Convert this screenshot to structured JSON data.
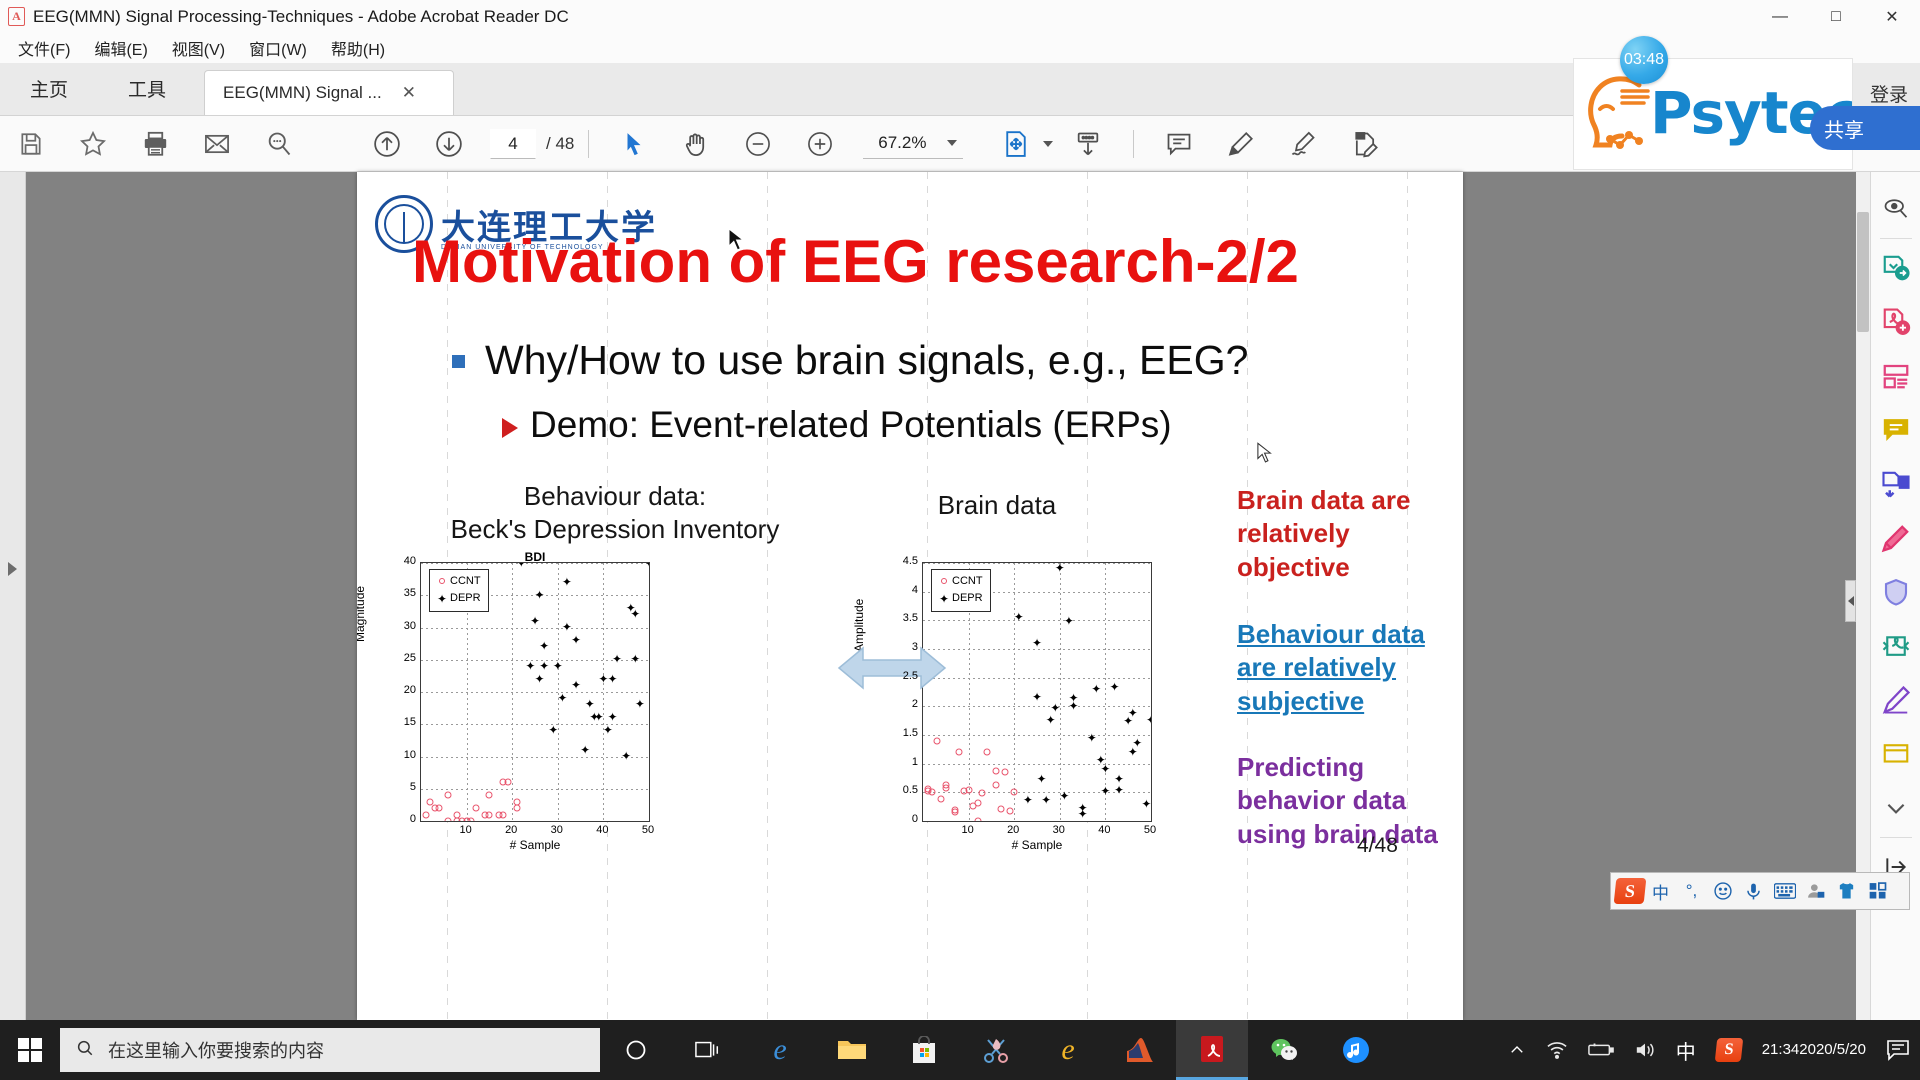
{
  "window": {
    "title": "EEG(MMN) Signal Processing-Techniques - Adobe Acrobat Reader DC",
    "app_icon": "pdf-file-icon",
    "minimize": "—",
    "maximize": "□",
    "close": "✕"
  },
  "menu": {
    "items": [
      {
        "label": "文件(F)",
        "name": "menu-file"
      },
      {
        "label": "编辑(E)",
        "name": "menu-edit"
      },
      {
        "label": "视图(V)",
        "name": "menu-view"
      },
      {
        "label": "窗口(W)",
        "name": "menu-window"
      },
      {
        "label": "帮助(H)",
        "name": "menu-help"
      }
    ]
  },
  "tabs": {
    "home": "主页",
    "tools": "工具",
    "document": "EEG(MMN) Signal ...",
    "close_glyph": "✕",
    "login": "登录"
  },
  "toolbar": {
    "page_current": "4",
    "page_total": "/ 48",
    "zoom_level": "67.2%",
    "icons": [
      "save-icon",
      "add-to-favorites-icon",
      "print-icon",
      "email-icon",
      "search-icon",
      "previous-page-icon",
      "next-page-icon",
      "select-tool-icon",
      "pan-tool-icon",
      "zoom-out-icon",
      "zoom-in-icon",
      "fit-page-icon",
      "scroll-mode-icon",
      "comment-icon",
      "highlight-icon",
      "sign-icon",
      "edit-pdf-icon"
    ]
  },
  "right_rail": {
    "items": [
      {
        "name": "search-document-icon",
        "color": "#4a4a4a"
      },
      {
        "name": "export-pdf-icon",
        "color": "#1a9d8f"
      },
      {
        "name": "create-pdf-icon",
        "color": "#e2436b"
      },
      {
        "name": "organize-pages-icon",
        "color": "#e2437f"
      },
      {
        "name": "comment-tool-icon",
        "color": "#d8b200"
      },
      {
        "name": "combine-files-icon",
        "color": "#4b4bd0"
      },
      {
        "name": "fill-and-sign-icon",
        "color": "#e0356f"
      },
      {
        "name": "protect-icon",
        "color": "#7f7fe0"
      },
      {
        "name": "compress-pdf-icon",
        "color": "#1f9b86"
      },
      {
        "name": "request-signature-icon",
        "color": "#7f45c9"
      },
      {
        "name": "more-tools-icon",
        "color": "#d8b200"
      },
      {
        "name": "chevron-down-icon",
        "color": "#555"
      },
      {
        "name": "collapse-pane-icon",
        "color": "#333"
      }
    ]
  },
  "slide": {
    "university_logo_text": "大连理工大学",
    "university_logo_sub": "DALIAN UNIVERSITY OF TECHNOLOGY",
    "title": "Motivation of EEG research-2/2",
    "bullet_level1": "Why/How to use brain signals, e.g., EEG?",
    "bullet_level2": "Demo: Event-related Potentials (ERPs)",
    "caption_left_line1": "Behaviour data:",
    "caption_left_line2": "Beck's Depression Inventory",
    "caption_right": "Brain data",
    "note_red": "Brain data are relatively objective",
    "note_blue": "Behaviour data are relatively subjective",
    "note_purple": "Predicting behavior data using brain data",
    "page_mark": "4/48",
    "colors": {
      "title_red": "#e8110f",
      "note_red": "#c9211e",
      "note_blue": "#1878b8",
      "note_purple": "#7b2f9e",
      "bullet_square_blue": "#2e6fba",
      "arrow_blue": "#b7cfe4"
    }
  },
  "chart_data": [
    {
      "type": "scatter",
      "name": "bdi-chart",
      "title": "BDI",
      "xlabel": "# Sample",
      "ylabel": "Magnitude",
      "xlim": [
        0,
        50
      ],
      "ylim": [
        0,
        40
      ],
      "xticks": [
        10,
        20,
        30,
        40,
        50
      ],
      "yticks": [
        0,
        5,
        10,
        15,
        20,
        25,
        30,
        35,
        40
      ],
      "grid": true,
      "legend": [
        "CCNT",
        "DEPR"
      ],
      "legend_position": "top-left",
      "series": [
        {
          "name": "CCNT",
          "marker": "open-circle",
          "color": "#e8536b",
          "points": [
            [
              1,
              1
            ],
            [
              2,
              3
            ],
            [
              3,
              2
            ],
            [
              4,
              2
            ],
            [
              6,
              4
            ],
            [
              6,
              0
            ],
            [
              8,
              1
            ],
            [
              8,
              0
            ],
            [
              9,
              0
            ],
            [
              10,
              0
            ],
            [
              10,
              0
            ],
            [
              11,
              0
            ],
            [
              12,
              2
            ],
            [
              14,
              1
            ],
            [
              15,
              1
            ],
            [
              15,
              4
            ],
            [
              17,
              1
            ],
            [
              18,
              1
            ],
            [
              18,
              6
            ],
            [
              19,
              6
            ],
            [
              21,
              3
            ],
            [
              21,
              2
            ]
          ]
        },
        {
          "name": "DEPR",
          "marker": "filled-star",
          "color": "#000000",
          "points": [
            [
              22,
              40
            ],
            [
              24,
              24
            ],
            [
              25,
              31
            ],
            [
              26,
              35
            ],
            [
              26,
              22
            ],
            [
              27,
              24
            ],
            [
              27,
              27
            ],
            [
              30,
              24
            ],
            [
              29,
              14
            ],
            [
              31,
              19
            ],
            [
              32,
              30
            ],
            [
              32,
              37
            ],
            [
              34,
              21
            ],
            [
              34,
              28
            ],
            [
              36,
              11
            ],
            [
              37,
              18
            ],
            [
              38,
              16
            ],
            [
              39,
              16
            ],
            [
              40,
              22
            ],
            [
              41,
              14
            ],
            [
              42,
              16
            ],
            [
              42,
              22
            ],
            [
              43,
              25
            ],
            [
              45,
              10
            ],
            [
              46,
              33
            ],
            [
              47,
              32
            ],
            [
              47,
              25
            ],
            [
              48,
              18
            ],
            [
              50,
              40
            ]
          ]
        }
      ]
    },
    {
      "type": "scatter",
      "name": "brain-amplitude-chart",
      "title": "",
      "xlabel": "# Sample",
      "ylabel": "Amplitude",
      "xlim": [
        0,
        50
      ],
      "ylim": [
        0,
        4.5
      ],
      "xticks": [
        10,
        20,
        30,
        40,
        50
      ],
      "yticks": [
        0,
        0.5,
        1,
        1.5,
        2,
        2.5,
        3,
        3.5,
        4,
        4.5
      ],
      "grid": true,
      "legend": [
        "CCNT",
        "DEPR"
      ],
      "legend_position": "top-left",
      "series": [
        {
          "name": "CCNT",
          "marker": "open-circle",
          "color": "#e8536b",
          "points": [
            [
              1,
              0.55
            ],
            [
              1,
              0.52
            ],
            [
              2,
              0.5
            ],
            [
              3,
              1.4
            ],
            [
              4,
              0.38
            ],
            [
              5,
              0.58
            ],
            [
              5,
              0.63
            ],
            [
              7,
              0.2
            ],
            [
              7,
              0.16
            ],
            [
              8,
              1.2
            ],
            [
              9,
              0.53
            ],
            [
              10,
              0.54
            ],
            [
              11,
              0.27
            ],
            [
              12,
              0.0
            ],
            [
              12,
              0.31
            ],
            [
              13,
              0.49
            ],
            [
              14,
              1.2
            ],
            [
              16,
              0.63
            ],
            [
              16,
              0.87
            ],
            [
              17,
              0.21
            ],
            [
              18,
              0.85
            ],
            [
              19,
              0.18
            ],
            [
              20,
              0.5
            ]
          ]
        },
        {
          "name": "DEPR",
          "marker": "filled-star",
          "color": "#000000",
          "points": [
            [
              21,
              3.55
            ],
            [
              23,
              0.35
            ],
            [
              25,
              2.15
            ],
            [
              25,
              3.1
            ],
            [
              26,
              0.73
            ],
            [
              27,
              0.35
            ],
            [
              28,
              1.76
            ],
            [
              29,
              1.96
            ],
            [
              30,
              4.4
            ],
            [
              31,
              0.43
            ],
            [
              32,
              3.48
            ],
            [
              33,
              2.0
            ],
            [
              33,
              2.14
            ],
            [
              35,
              0.12
            ],
            [
              35,
              0.22
            ],
            [
              37,
              1.44
            ],
            [
              38,
              2.3
            ],
            [
              39,
              1.06
            ],
            [
              40,
              0.51
            ],
            [
              40,
              0.9
            ],
            [
              42,
              2.33
            ],
            [
              43,
              0.53
            ],
            [
              43,
              0.73
            ],
            [
              45,
              1.73
            ],
            [
              46,
              1.87
            ],
            [
              46,
              1.2
            ],
            [
              47,
              1.36
            ],
            [
              49,
              0.28
            ],
            [
              50,
              1.75
            ]
          ]
        }
      ]
    }
  ],
  "overlay": {
    "psytech_brand": "Psytech",
    "timer": "03:48",
    "share_label": "共享"
  },
  "ime": {
    "logo": "S",
    "mode": "中",
    "punctuation": "°,",
    "items": [
      "sogou-logo-icon",
      "chinese-mode-icon",
      "punctuation-icon",
      "emoji-icon",
      "voice-input-icon",
      "soft-keyboard-icon",
      "user-icon",
      "skin-icon",
      "toolbox-icon"
    ]
  },
  "taskbar": {
    "search_placeholder": "在这里输入你要搜索的内容",
    "apps": [
      {
        "name": "cortana-icon",
        "glyph": "◯"
      },
      {
        "name": "task-view-icon",
        "glyph": "❑"
      },
      {
        "name": "edge-icon",
        "glyph": "e"
      },
      {
        "name": "file-explorer-icon",
        "glyph": "▤"
      },
      {
        "name": "microsoft-store-icon",
        "glyph": "▣"
      },
      {
        "name": "snipaste-icon",
        "glyph": "✂"
      },
      {
        "name": "internet-explorer-icon",
        "glyph": "e"
      },
      {
        "name": "matlab-icon",
        "glyph": "▲"
      },
      {
        "name": "acrobat-reader-icon",
        "glyph": "A"
      },
      {
        "name": "wechat-icon",
        "glyph": "◕"
      },
      {
        "name": "qq-music-icon",
        "glyph": "♪"
      }
    ],
    "tray": {
      "chevron": "︿",
      "wifi": "wifi-icon",
      "battery": "battery-icon",
      "volume": "volume-icon",
      "ime_mode": "中",
      "sogou": "S",
      "time": "21:34",
      "date": "2020/5/20",
      "notifications": "action-center-icon"
    }
  }
}
